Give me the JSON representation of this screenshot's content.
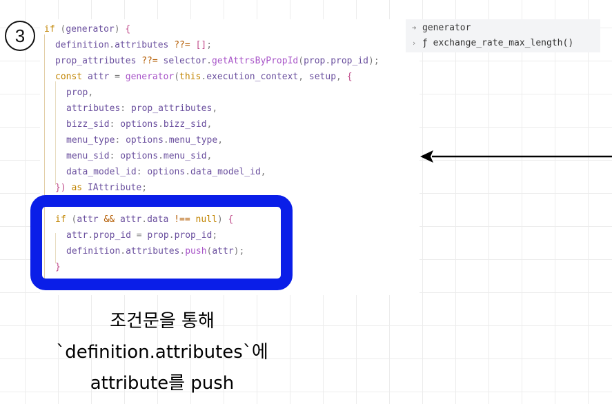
{
  "step": {
    "number": "3"
  },
  "code": {
    "lines": [
      [
        [
          "kw",
          "if"
        ],
        [
          "punc",
          " ("
        ],
        [
          "ident",
          "generator"
        ],
        [
          "punc",
          ") "
        ],
        [
          "brace",
          "{"
        ]
      ],
      [
        [
          "ident",
          "definition"
        ],
        [
          "punc",
          "."
        ],
        [
          "ident",
          "attributes"
        ],
        [
          "punc",
          " "
        ],
        [
          "op",
          "??="
        ],
        [
          "punc",
          " "
        ],
        [
          "brace",
          "[]"
        ],
        [
          "punc",
          ";"
        ]
      ],
      [
        [
          "ident",
          "prop_attributes"
        ],
        [
          "punc",
          " "
        ],
        [
          "op",
          "??="
        ],
        [
          "punc",
          " "
        ],
        [
          "ident",
          "selector"
        ],
        [
          "punc",
          "."
        ],
        [
          "fn",
          "getAttrsByPropId"
        ],
        [
          "punc",
          "("
        ],
        [
          "ident",
          "prop"
        ],
        [
          "punc",
          "."
        ],
        [
          "ident",
          "prop_id"
        ],
        [
          "punc",
          ");"
        ]
      ],
      [
        [
          "kw",
          "const"
        ],
        [
          "punc",
          " "
        ],
        [
          "ident",
          "attr"
        ],
        [
          "punc",
          " = "
        ],
        [
          "fn",
          "generator"
        ],
        [
          "punc",
          "("
        ],
        [
          "kw",
          "this"
        ],
        [
          "punc",
          "."
        ],
        [
          "ident",
          "execution_context"
        ],
        [
          "punc",
          ", "
        ],
        [
          "ident",
          "setup"
        ],
        [
          "punc",
          ", "
        ],
        [
          "brace",
          "{"
        ]
      ],
      [
        [
          "ident",
          "prop"
        ],
        [
          "punc",
          ","
        ]
      ],
      [
        [
          "ident",
          "attributes"
        ],
        [
          "punc",
          ": "
        ],
        [
          "ident",
          "prop_attributes"
        ],
        [
          "punc",
          ","
        ]
      ],
      [
        [
          "ident",
          "bizz_sid"
        ],
        [
          "punc",
          ": "
        ],
        [
          "ident",
          "options"
        ],
        [
          "punc",
          "."
        ],
        [
          "ident",
          "bizz_sid"
        ],
        [
          "punc",
          ","
        ]
      ],
      [
        [
          "ident",
          "menu_type"
        ],
        [
          "punc",
          ": "
        ],
        [
          "ident",
          "options"
        ],
        [
          "punc",
          "."
        ],
        [
          "ident",
          "menu_type"
        ],
        [
          "punc",
          ","
        ]
      ],
      [
        [
          "ident",
          "menu_sid"
        ],
        [
          "punc",
          ": "
        ],
        [
          "ident",
          "options"
        ],
        [
          "punc",
          "."
        ],
        [
          "ident",
          "menu_sid"
        ],
        [
          "punc",
          ","
        ]
      ],
      [
        [
          "ident",
          "data_model_id"
        ],
        [
          "punc",
          ": "
        ],
        [
          "ident",
          "options"
        ],
        [
          "punc",
          "."
        ],
        [
          "ident",
          "data_model_id"
        ],
        [
          "punc",
          ","
        ]
      ],
      [
        [
          "brace",
          "})"
        ],
        [
          "punc",
          " "
        ],
        [
          "kw",
          "as"
        ],
        [
          "punc",
          " "
        ],
        [
          "ident",
          "IAttribute"
        ],
        [
          "punc",
          ";"
        ]
      ],
      [],
      [
        [
          "kw",
          "if"
        ],
        [
          "punc",
          " ("
        ],
        [
          "ident",
          "attr"
        ],
        [
          "punc",
          " "
        ],
        [
          "op",
          "&&"
        ],
        [
          "punc",
          " "
        ],
        [
          "ident",
          "attr"
        ],
        [
          "punc",
          "."
        ],
        [
          "ident",
          "data"
        ],
        [
          "punc",
          " "
        ],
        [
          "op",
          "!=="
        ],
        [
          "punc",
          " "
        ],
        [
          "kw",
          "null"
        ],
        [
          "punc",
          ") "
        ],
        [
          "brace",
          "{"
        ]
      ],
      [
        [
          "ident",
          "attr"
        ],
        [
          "punc",
          "."
        ],
        [
          "ident",
          "prop_id"
        ],
        [
          "punc",
          " = "
        ],
        [
          "ident",
          "prop"
        ],
        [
          "punc",
          "."
        ],
        [
          "ident",
          "prop_id"
        ],
        [
          "punc",
          ";"
        ]
      ],
      [
        [
          "ident",
          "definition"
        ],
        [
          "punc",
          "."
        ],
        [
          "ident",
          "attributes"
        ],
        [
          "punc",
          "."
        ],
        [
          "fn",
          "push"
        ],
        [
          "punc",
          "("
        ],
        [
          "ident",
          "attr"
        ],
        [
          "punc",
          ");"
        ]
      ],
      [
        [
          "brace",
          "}"
        ]
      ]
    ]
  },
  "hover_panel": {
    "items": [
      {
        "icon": "property-icon",
        "glyph": "➜",
        "text": "generator"
      },
      {
        "icon": "function-icon",
        "glyph": "›",
        "text": "ƒ exchange_rate_max_length()"
      }
    ]
  },
  "caption": {
    "line1": "조건문을 통해",
    "line2": "`definition.attributes`에",
    "line3": "attribute를 push"
  },
  "colors": {
    "highlight_border": "#0a1ee8",
    "arrow": "#000000"
  }
}
